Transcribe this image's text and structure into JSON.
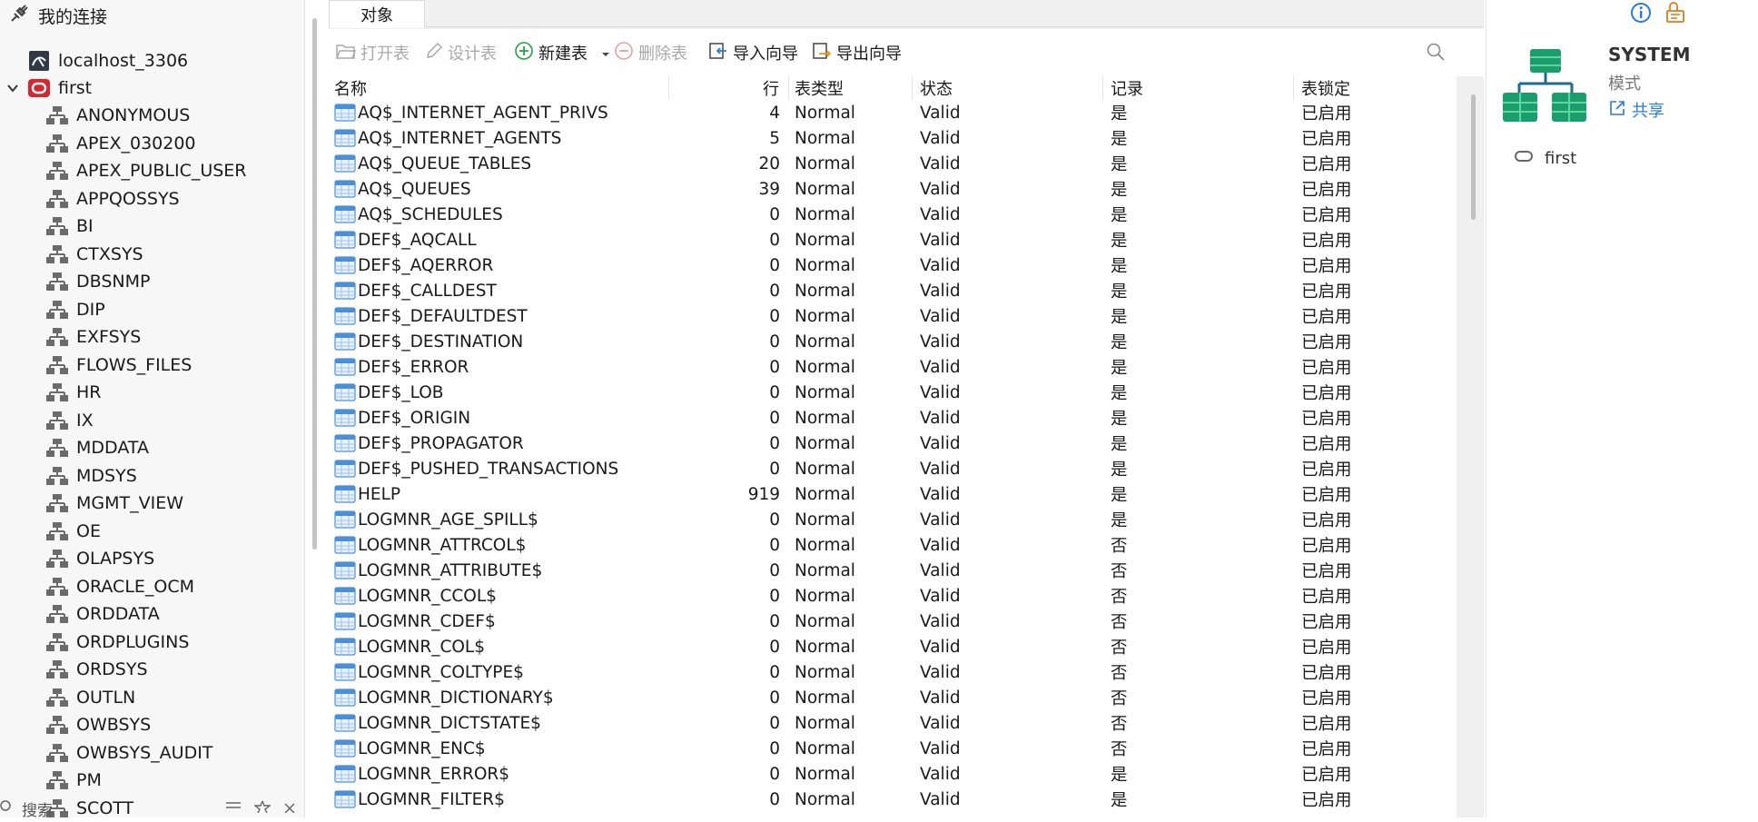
{
  "sidebar": {
    "header_label": "我的连接",
    "connection": "localhost_3306",
    "database": "first",
    "schemas": [
      "ANONYMOUS",
      "APEX_030200",
      "APEX_PUBLIC_USER",
      "APPQOSSYS",
      "BI",
      "CTXSYS",
      "DBSNMP",
      "DIP",
      "EXFSYS",
      "FLOWS_FILES",
      "HR",
      "IX",
      "MDDATA",
      "MDSYS",
      "MGMT_VIEW",
      "OE",
      "OLAPSYS",
      "ORACLE_OCM",
      "ORDDATA",
      "ORDPLUGINS",
      "ORDSYS",
      "OUTLN",
      "OWBSYS",
      "OWBSYS_AUDIT",
      "PM",
      "SCOTT"
    ],
    "search_placeholder": "搜索"
  },
  "main": {
    "tab_label": "对象",
    "toolbar": {
      "open_table": "打开表",
      "design_table": "设计表",
      "new_table": "新建表",
      "delete_table": "删除表",
      "import_wizard": "导入向导",
      "export_wizard": "导出向导"
    },
    "columns": [
      "名称",
      "行",
      "表类型",
      "状态",
      "记录",
      "表锁定"
    ],
    "rows": [
      [
        "AQ$_INTERNET_AGENT_PRIVS",
        "4",
        "Normal",
        "Valid",
        "是",
        "已启用"
      ],
      [
        "AQ$_INTERNET_AGENTS",
        "5",
        "Normal",
        "Valid",
        "是",
        "已启用"
      ],
      [
        "AQ$_QUEUE_TABLES",
        "20",
        "Normal",
        "Valid",
        "是",
        "已启用"
      ],
      [
        "AQ$_QUEUES",
        "39",
        "Normal",
        "Valid",
        "是",
        "已启用"
      ],
      [
        "AQ$_SCHEDULES",
        "0",
        "Normal",
        "Valid",
        "是",
        "已启用"
      ],
      [
        "DEF$_AQCALL",
        "0",
        "Normal",
        "Valid",
        "是",
        "已启用"
      ],
      [
        "DEF$_AQERROR",
        "0",
        "Normal",
        "Valid",
        "是",
        "已启用"
      ],
      [
        "DEF$_CALLDEST",
        "0",
        "Normal",
        "Valid",
        "是",
        "已启用"
      ],
      [
        "DEF$_DEFAULTDEST",
        "0",
        "Normal",
        "Valid",
        "是",
        "已启用"
      ],
      [
        "DEF$_DESTINATION",
        "0",
        "Normal",
        "Valid",
        "是",
        "已启用"
      ],
      [
        "DEF$_ERROR",
        "0",
        "Normal",
        "Valid",
        "是",
        "已启用"
      ],
      [
        "DEF$_LOB",
        "0",
        "Normal",
        "Valid",
        "是",
        "已启用"
      ],
      [
        "DEF$_ORIGIN",
        "0",
        "Normal",
        "Valid",
        "是",
        "已启用"
      ],
      [
        "DEF$_PROPAGATOR",
        "0",
        "Normal",
        "Valid",
        "是",
        "已启用"
      ],
      [
        "DEF$_PUSHED_TRANSACTIONS",
        "0",
        "Normal",
        "Valid",
        "是",
        "已启用"
      ],
      [
        "HELP",
        "919",
        "Normal",
        "Valid",
        "是",
        "已启用"
      ],
      [
        "LOGMNR_AGE_SPILL$",
        "0",
        "Normal",
        "Valid",
        "是",
        "已启用"
      ],
      [
        "LOGMNR_ATTRCOL$",
        "0",
        "Normal",
        "Valid",
        "否",
        "已启用"
      ],
      [
        "LOGMNR_ATTRIBUTE$",
        "0",
        "Normal",
        "Valid",
        "否",
        "已启用"
      ],
      [
        "LOGMNR_CCOL$",
        "0",
        "Normal",
        "Valid",
        "否",
        "已启用"
      ],
      [
        "LOGMNR_CDEF$",
        "0",
        "Normal",
        "Valid",
        "否",
        "已启用"
      ],
      [
        "LOGMNR_COL$",
        "0",
        "Normal",
        "Valid",
        "否",
        "已启用"
      ],
      [
        "LOGMNR_COLTYPE$",
        "0",
        "Normal",
        "Valid",
        "否",
        "已启用"
      ],
      [
        "LOGMNR_DICTIONARY$",
        "0",
        "Normal",
        "Valid",
        "否",
        "已启用"
      ],
      [
        "LOGMNR_DICTSTATE$",
        "0",
        "Normal",
        "Valid",
        "否",
        "已启用"
      ],
      [
        "LOGMNR_ENC$",
        "0",
        "Normal",
        "Valid",
        "否",
        "已启用"
      ],
      [
        "LOGMNR_ERROR$",
        "0",
        "Normal",
        "Valid",
        "是",
        "已启用"
      ],
      [
        "LOGMNR_FILTER$",
        "0",
        "Normal",
        "Valid",
        "是",
        "已启用"
      ]
    ]
  },
  "info": {
    "schema_name": "SYSTEM",
    "schema_type": "模式",
    "share_label": "共享",
    "connection_name": "first"
  },
  "colors": {
    "accent": "#2b7bd6",
    "oracle_red": "#d8272c",
    "schema_green": "#1b9e6b",
    "table_blue": "#4a8fd8"
  }
}
